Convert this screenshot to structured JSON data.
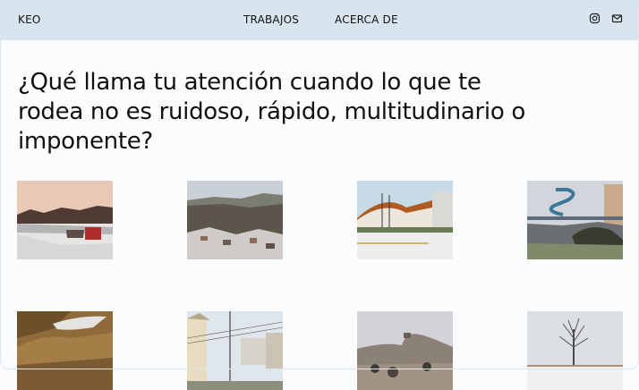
{
  "nav": {
    "brand": "KEO",
    "links": [
      "TRABAJOS",
      "ACERCA DE"
    ],
    "icons": [
      "instagram-icon",
      "mail-icon"
    ]
  },
  "hero": {
    "title": "¿Qué llama tu atención cuando lo que te rodea no es ruidoso, rápido, multitudinario o imponente?"
  },
  "gallery": {
    "items": [
      {
        "name": "winter-lake-shore-photo"
      },
      {
        "name": "snowy-valley-town-photo"
      },
      {
        "name": "sports-hall-photo"
      },
      {
        "name": "waterslide-pool-photo"
      },
      {
        "name": "rock-cliff-photo"
      },
      {
        "name": "power-lines-houses-photo"
      },
      {
        "name": "hilltop-castle-photo"
      },
      {
        "name": "lone-tree-snow-photo"
      }
    ]
  }
}
